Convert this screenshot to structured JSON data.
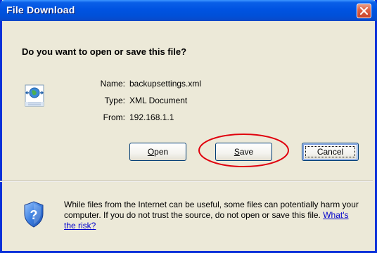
{
  "window": {
    "title": "File Download",
    "close_label": "Close"
  },
  "prompt": {
    "question": "Do you want to open or save this file?"
  },
  "file": {
    "icon": "xml-document-icon",
    "name_label": "Name:",
    "name_value": "backupsettings.xml",
    "type_label": "Type:",
    "type_value": "XML Document",
    "from_label": "From:",
    "from_value": "192.168.1.1"
  },
  "buttons": {
    "open": "Open",
    "save": "Save",
    "cancel": "Cancel"
  },
  "warning": {
    "icon": "security-shield-icon",
    "text": "While files from the Internet can be useful, some files can potentially harm your computer. If you do not trust the source, do not open or save this file.",
    "link": "What's the risk?"
  },
  "colors": {
    "titlebar": "#0053e1",
    "dialog_bg": "#ece9d8",
    "highlight_ellipse": "#e0000d",
    "link": "#0000cc"
  }
}
